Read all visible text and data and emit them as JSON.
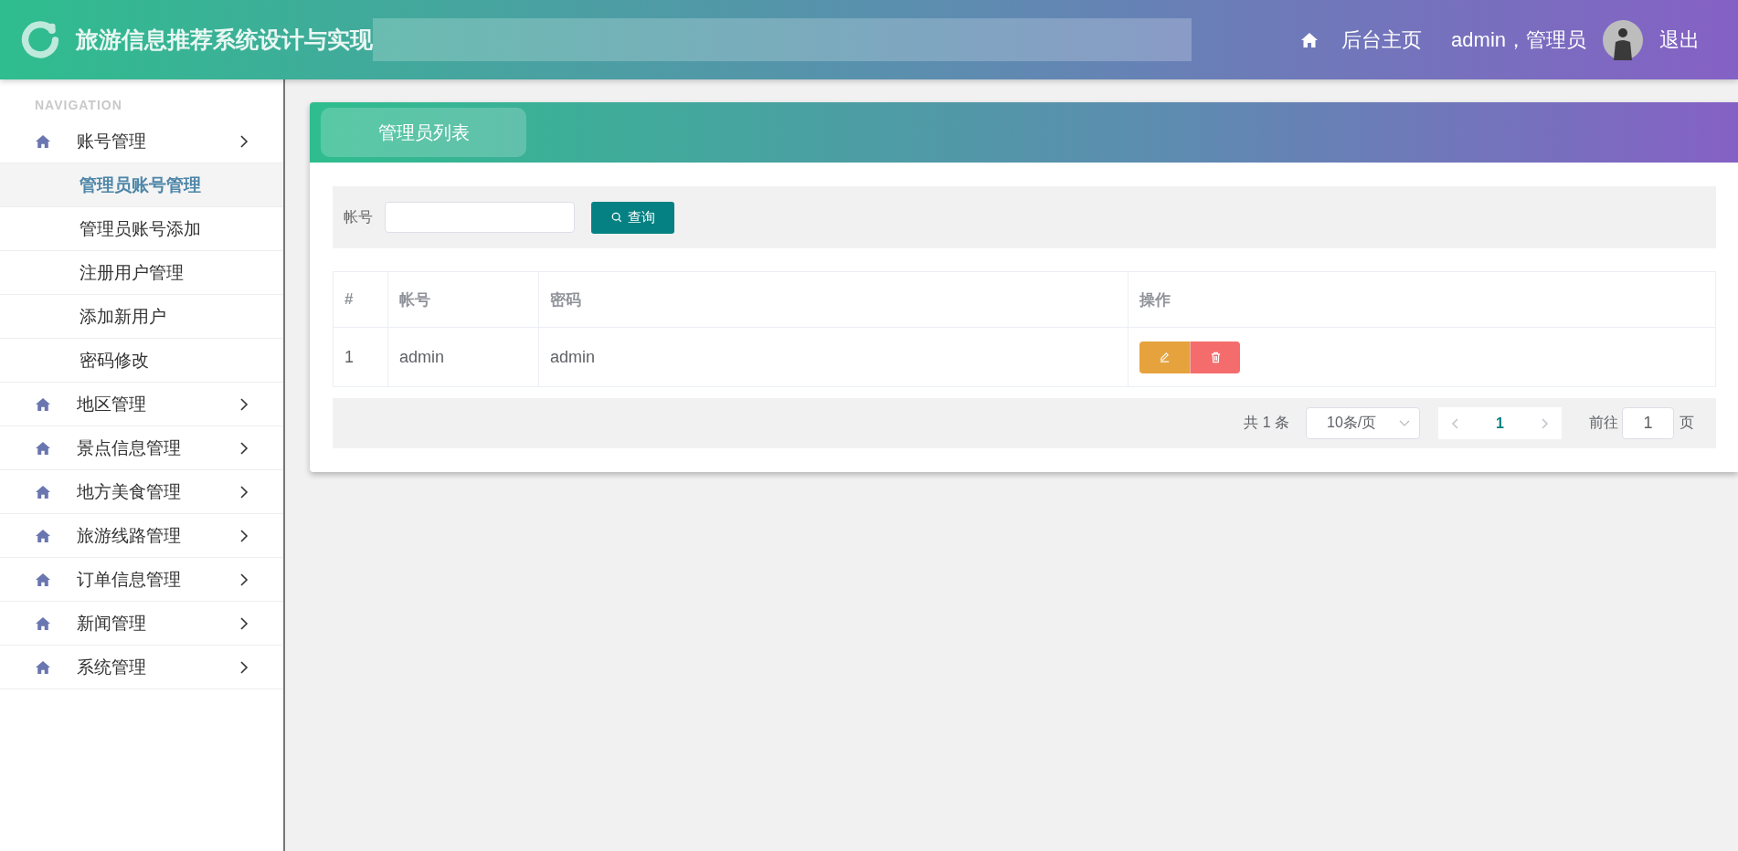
{
  "header": {
    "title": "旅游信息推荐系统设计与实现",
    "links": [
      "后台主页"
    ],
    "user": "admin，管理员",
    "logout": "退出"
  },
  "sidebar": {
    "heading": "NAVIGATION",
    "items": [
      {
        "label": "账号管理",
        "children": [
          {
            "label": "管理员账号管理",
            "selected": true
          },
          {
            "label": "管理员账号添加",
            "selected": false
          },
          {
            "label": "注册用户管理",
            "selected": false
          },
          {
            "label": "添加新用户",
            "selected": false
          },
          {
            "label": "密码修改",
            "selected": false
          }
        ]
      },
      {
        "label": "地区管理"
      },
      {
        "label": "景点信息管理"
      },
      {
        "label": "地方美食管理"
      },
      {
        "label": "旅游线路管理"
      },
      {
        "label": "订单信息管理"
      },
      {
        "label": "新闻管理"
      },
      {
        "label": "系统管理"
      }
    ]
  },
  "panel": {
    "tab": "管理员列表",
    "search": {
      "label": "帐号",
      "button": "查询"
    },
    "table": {
      "columns": [
        "#",
        "帐号",
        "密码",
        "操作"
      ],
      "rows": [
        [
          "1",
          "admin",
          "admin"
        ]
      ]
    },
    "pagination": {
      "total": "共 1 条",
      "page_size": "10条/页",
      "pages": [
        {
          "label": "1",
          "selected": true
        }
      ],
      "goto_label": "前往",
      "goto_value": "1",
      "goto_suffix": "页"
    }
  }
}
